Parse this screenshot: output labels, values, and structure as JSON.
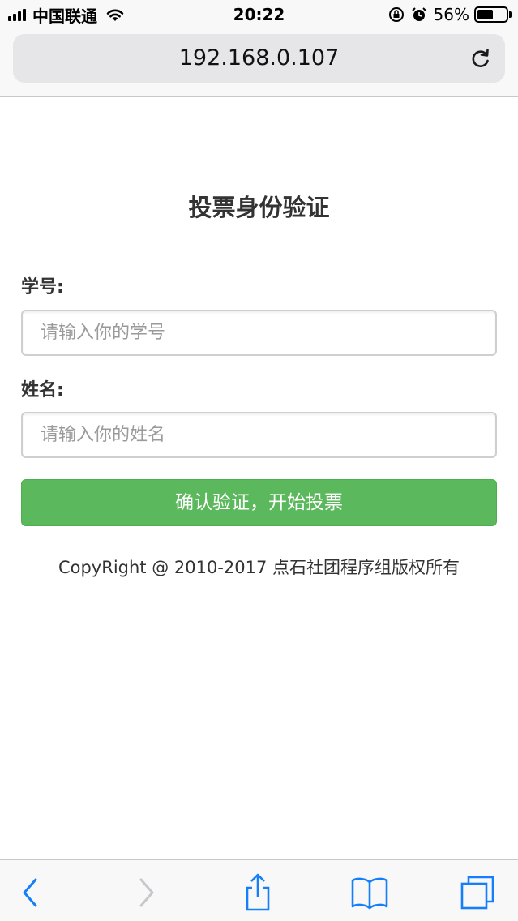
{
  "status_bar": {
    "carrier": "中国联通",
    "time": "20:22",
    "battery_percent": "56%",
    "battery_level": 0.56,
    "icons": [
      "signal-icon",
      "wifi-icon",
      "orientation-lock-icon",
      "alarm-icon",
      "battery-icon"
    ]
  },
  "browser": {
    "url": "192.168.0.107",
    "reload_icon": "reload-icon"
  },
  "page": {
    "title": "投票身份验证",
    "student_id": {
      "label": "学号:",
      "placeholder": "请输入你的学号",
      "value": ""
    },
    "name": {
      "label": "姓名:",
      "placeholder": "请输入你的姓名",
      "value": ""
    },
    "submit_label": "确认验证，开始投票",
    "copyright": "CopyRight @ 2010-2017 点石社团程序组版权所有"
  },
  "toolbar": {
    "items": [
      "back-icon",
      "forward-icon",
      "share-icon",
      "bookmarks-icon",
      "tabs-icon"
    ]
  },
  "colors": {
    "primary_button": "#5cb85c",
    "ios_blue": "#157efb",
    "disabled_gray": "#c7c7cc"
  }
}
